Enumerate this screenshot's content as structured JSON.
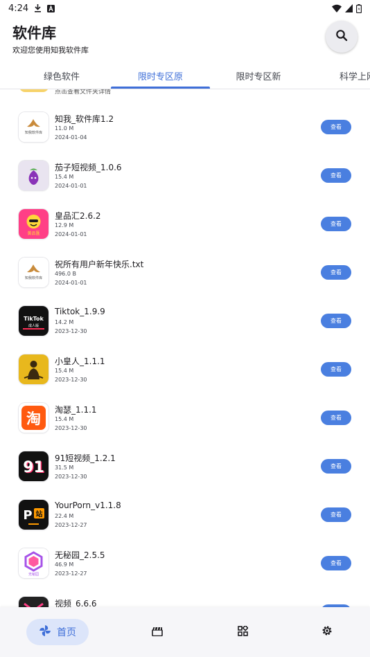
{
  "status_bar": {
    "time": "4:24"
  },
  "header": {
    "title": "软件库",
    "subtitle": "欢迎您使用知我软件库"
  },
  "tabs": [
    {
      "label": "绿色软件"
    },
    {
      "label": "限时专区原"
    },
    {
      "label": "限时专区新"
    },
    {
      "label": "科学上网"
    }
  ],
  "partial_item": {
    "text": "点击查看文件夹详情"
  },
  "view_label": "查看",
  "apps": [
    {
      "name": "知我_软件库1.2",
      "size": "11.0 M",
      "date": "2024-01-04",
      "icon": "zhiwo-icon"
    },
    {
      "name": "茄子短视频_1.0.6",
      "size": "15.4 M",
      "date": "2024-01-01",
      "icon": "eggplant-icon"
    },
    {
      "name": "皇品汇2.6.2",
      "size": "12.9 M",
      "date": "2024-01-01",
      "icon": "huangpinhui-icon"
    },
    {
      "name": "祝所有用户新年快乐.txt",
      "size": "496.0 B",
      "date": "2024-01-01",
      "icon": "zhiwo-icon"
    },
    {
      "name": "Tiktok_1.9.9",
      "size": "14.2 M",
      "date": "2023-12-30",
      "icon": "tiktok-icon"
    },
    {
      "name": "小皇人_1.1.1",
      "size": "15.4 M",
      "date": "2023-12-30",
      "icon": "xiaohuangren-icon"
    },
    {
      "name": "淘瑟_1.1.1",
      "size": "15.4 M",
      "date": "2023-12-30",
      "icon": "taose-icon"
    },
    {
      "name": "91短视频_1.2.1",
      "size": "31.5 M",
      "date": "2023-12-30",
      "icon": "91-icon"
    },
    {
      "name": "YourPorn_v1.1.8",
      "size": "22.4 M",
      "date": "2023-12-27",
      "icon": "yourporn-icon"
    },
    {
      "name": "无秘园_2.5.5",
      "size": "46.9 M",
      "date": "2023-12-27",
      "icon": "wumiyuan-icon"
    },
    {
      "name": "视频_6.6.6",
      "size": "",
      "date": "",
      "icon": "video-app-icon"
    }
  ],
  "icon_text": {
    "zhiwo": "知我软件库",
    "huangpinhui": "黄品匯",
    "tiktok_top": "TikTok",
    "tiktok_bottom": "成人版",
    "taose": "淘",
    "n91": "91",
    "yourporn_p": "P",
    "yourporn_zhan": "站",
    "wumiyuan": "无秘园"
  },
  "bottom_nav": {
    "home_label": "首页"
  },
  "colors": {
    "accent": "#3f6fd8",
    "button": "#4a7fe0",
    "indicator": "#3f6fd8"
  }
}
